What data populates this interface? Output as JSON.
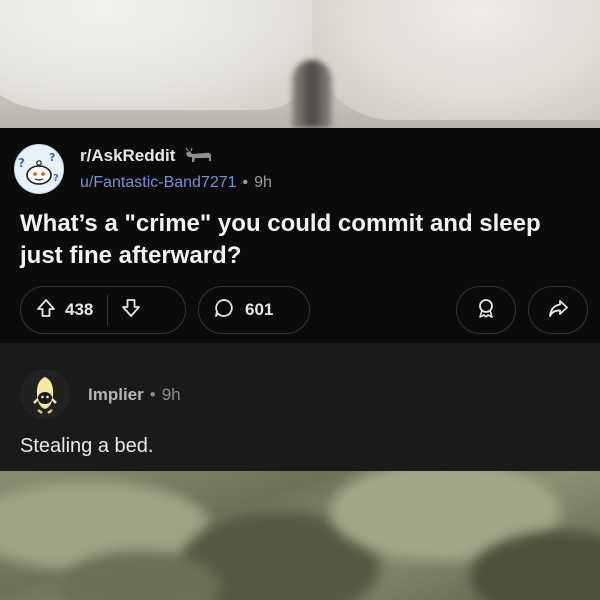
{
  "post": {
    "subreddit": "r/AskReddit",
    "username": "u/Fantastic-Band7271",
    "separator": "•",
    "age": "9h",
    "title": "What’s a \"crime\" you could commit and sleep just fine afterward?",
    "upvotes": "438",
    "comments": "601",
    "icons": {
      "subreddit_avatar": "askreddit-snoo-icon",
      "user_award": "bull-award-icon",
      "upvote": "upvote-arrow-icon",
      "downvote": "downvote-arrow-icon",
      "comment": "comment-bubble-icon",
      "award": "award-ribbon-icon",
      "share": "share-arrow-icon"
    }
  },
  "comment": {
    "username": "Implier",
    "separator": "•",
    "age": "9h",
    "body": "Stealing a bed.",
    "avatar_icon": "snoo-avatar-icon"
  },
  "colors": {
    "post_bg": "#0b0b0c",
    "comment_bg": "#1a1a1b",
    "username_link": "#7b8fd6",
    "pill_border": "#343436"
  }
}
